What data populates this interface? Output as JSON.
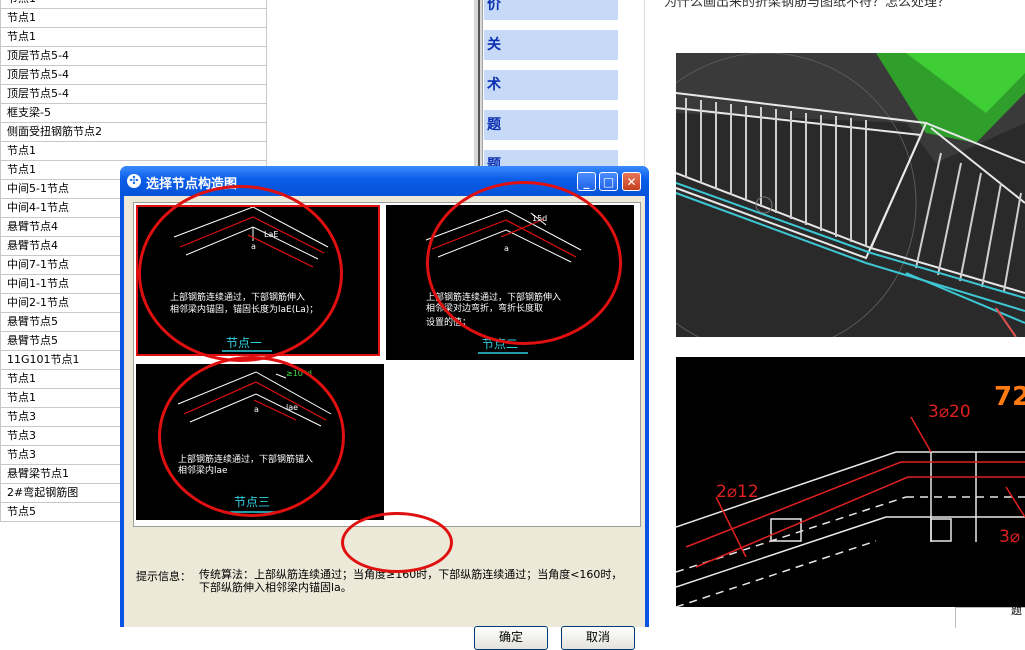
{
  "left_list": {
    "items": [
      "节点1",
      "节点1",
      "节点1",
      "顶层节点5-4",
      "顶层节点5-4",
      "顶层节点5-4",
      "框支梁-5",
      "侧面受扭钢筋节点2",
      "节点1",
      "节点1",
      "中间5-1节点",
      "中间4-1节点",
      "悬臂节点4",
      "悬臂节点4",
      "中间7-1节点",
      "中间1-1节点",
      "中间2-1节点",
      "悬臂节点5",
      "悬臂节点5",
      "11G101节点1",
      "节点1",
      "节点1",
      "节点3",
      "节点3",
      "节点3",
      "悬臂梁节点1",
      "2#弯起钢筋图",
      "节点5"
    ]
  },
  "mid_panel": {
    "chars": [
      "价",
      "关",
      "术",
      "题",
      "题"
    ]
  },
  "question": "为什么画出来的折梁钢筋与图纸不符？怎么处理？",
  "dialog": {
    "title": "选择节点构造图",
    "minimize": "_",
    "maximize": "□",
    "close": "✕",
    "title_icon": "✣",
    "nodes": [
      {
        "caption": "节点一",
        "desc1": "上部钢筋连续通过，下部钢筋伸入",
        "desc2": "相邻梁内锚固，锚固长度为laE(La)；",
        "desc3": "",
        "dim": "LaE"
      },
      {
        "caption": "节点二",
        "desc1": "上部钢筋连续通过，下部钢筋伸入",
        "desc2": "相邻梁对边弯折，弯折长度取",
        "desc3": "设置的值；",
        "dim": "15d"
      },
      {
        "caption": "节点三",
        "desc1": "上部钢筋连续通过，下部钢筋锚入",
        "desc2": "相邻梁内lae",
        "desc3": "",
        "dim": "≥10*d",
        "dim2": "lae"
      }
    ],
    "angle_label": "a",
    "hint_label": "提示信息：",
    "hint_text": "传统算法：上部纵筋连续通过；当角度≥160时，下部纵筋连续通过；当角度<160时，下部纵筋伸入相邻梁内锚固la。",
    "ok": "确定",
    "cancel": "取消"
  },
  "cad": {
    "label_top": "3⌀20",
    "label_left": "2⌀12",
    "label_right": "3⌀",
    "label_big": "72"
  },
  "bottom_frame_text": "题"
}
